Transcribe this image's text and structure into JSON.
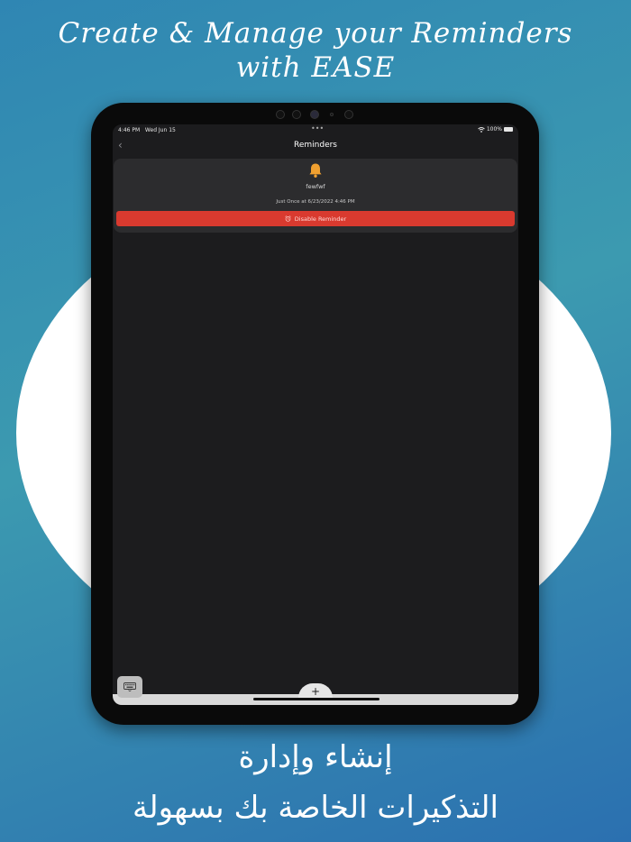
{
  "promo": {
    "title_line1": "Create & Manage your Reminders",
    "title_line2": "with EASE",
    "arabic_line1": "إنشاء وإدارة",
    "arabic_line2": "التذكيرات الخاصة بك بسهولة"
  },
  "status_bar": {
    "time": "4:46 PM",
    "date": "Wed Jun 15",
    "battery": "100%",
    "multitask_dots": "•••"
  },
  "nav": {
    "title": "Reminders",
    "back_glyph": "‹"
  },
  "reminder": {
    "name": "fewfwf",
    "schedule": "Just Once at 6/23/2022 4:46 PM",
    "disable_label": "Disable Reminder",
    "icon": "bell-icon"
  },
  "toolbar": {
    "add_glyph": "+",
    "keyboard_icon": "keyboard-icon"
  },
  "colors": {
    "accent_red": "#d93a2f",
    "bell_orange": "#f0a030",
    "screen_bg": "#1c1c1e",
    "card_bg": "#2c2c2e"
  }
}
